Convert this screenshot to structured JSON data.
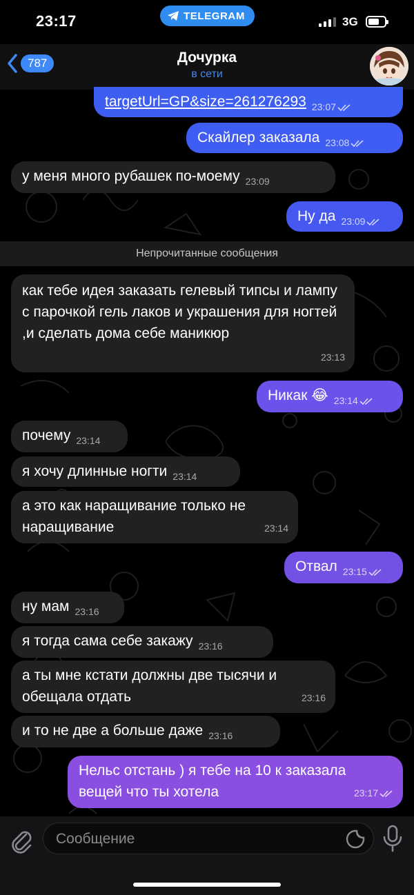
{
  "status_bar": {
    "time": "23:17",
    "pill": "TELEGRAM",
    "network": "3G"
  },
  "header": {
    "back_badge": "787",
    "title": "Дочурка",
    "subtitle": "в сети"
  },
  "unread_divider": "Непрочитанные сообщения",
  "messages": [
    {
      "dir": "out",
      "text": "targetUrl=GP&size=261276293",
      "time": "23:07"
    },
    {
      "dir": "out",
      "text": "Скайлер заказала",
      "time": "23:08"
    },
    {
      "dir": "in",
      "text": "у меня много рубашек по-моему",
      "time": "23:09"
    },
    {
      "dir": "out",
      "text": "Ну да",
      "time": "23:09"
    },
    {
      "dir": "in",
      "text": "как тебе идея заказать гелевый типсы и лампу с парочкой гель лаков и украшения для ногтей ,и сделать дома себе маникюр",
      "time": "23:13"
    },
    {
      "dir": "out",
      "text": "Никак 😂",
      "time": "23:14"
    },
    {
      "dir": "in",
      "text": "почему",
      "time": "23:14"
    },
    {
      "dir": "in",
      "text": "я хочу длинные ногти",
      "time": "23:14"
    },
    {
      "dir": "in",
      "text": "а это как наращивание только не наращивание",
      "time": "23:14"
    },
    {
      "dir": "out",
      "text": "Отвал",
      "time": "23:15"
    },
    {
      "dir": "in",
      "text": "ну мам",
      "time": "23:16"
    },
    {
      "dir": "in",
      "text": "я тогда сама себе закажу",
      "time": "23:16"
    },
    {
      "dir": "in",
      "text": "а ты мне кстати должны две тысячи и обещала отдать",
      "time": "23:16"
    },
    {
      "dir": "in",
      "text": "и то не две а больше даже",
      "time": "23:16"
    },
    {
      "dir": "out",
      "text": "Нельс отстань ) я тебе на 10 к заказала вещей что ты хотела",
      "time": "23:17"
    }
  ],
  "input": {
    "placeholder": "Сообщение"
  },
  "colors": {
    "accent": "#3e88f7",
    "incoming": "#212023",
    "outgoing_top": "#3b5cf0",
    "outgoing_bottom": "#8b4fe0"
  },
  "icons": [
    "telegram-icon",
    "back-chevron-icon",
    "read-ticks-icon",
    "attach-icon",
    "sticker-icon",
    "mic-icon"
  ]
}
